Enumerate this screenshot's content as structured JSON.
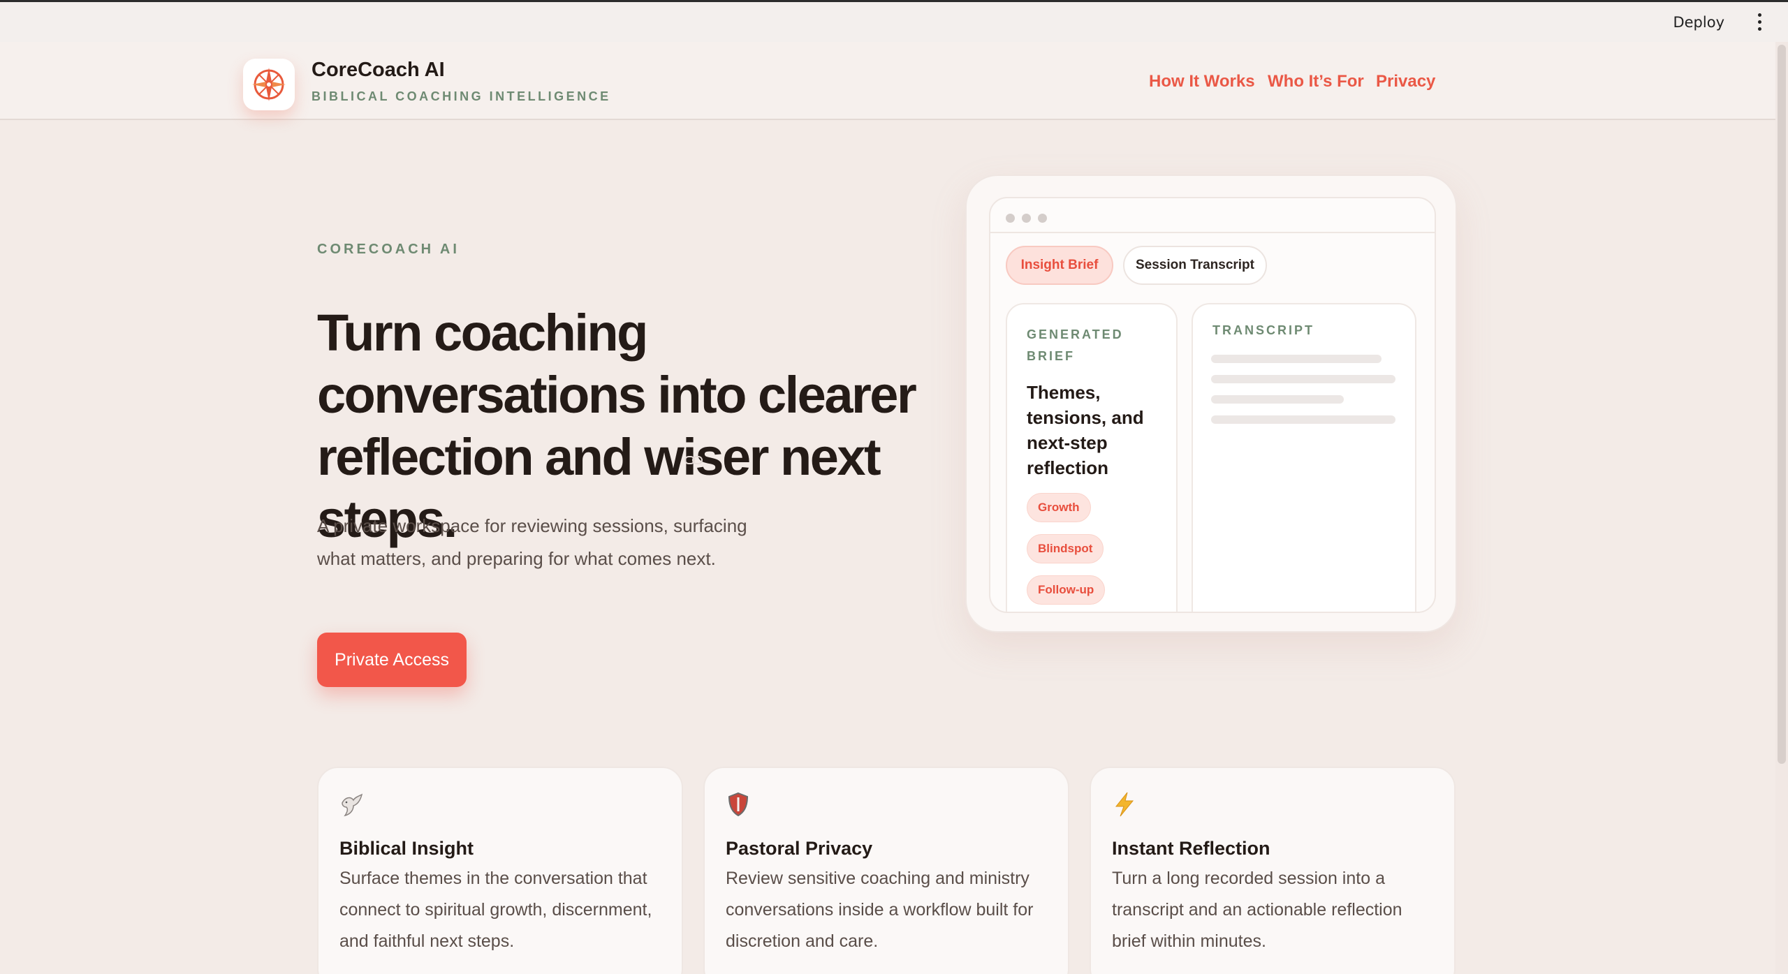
{
  "topbar": {
    "deploy_label": "Deploy",
    "menu_icon": "kebab-menu-icon"
  },
  "header": {
    "logo_icon": "compass-icon",
    "title": "CoreCoach AI",
    "subtitle": "BIBLICAL COACHING INTELLIGENCE",
    "nav": [
      {
        "label": "How It Works"
      },
      {
        "label": "Who It’s For"
      },
      {
        "label": "Privacy"
      }
    ]
  },
  "hero": {
    "eyebrow": "CORECOACH AI",
    "headline": "Turn coaching conversations into clearer reflection and wiser next steps.",
    "subtext": "A private workspace for reviewing sessions, surfacing what matters, and preparing for what comes next.",
    "cta_label": "Private Access",
    "link_icon": "link-icon"
  },
  "mockup": {
    "tabs": [
      {
        "label": "Insight Brief"
      },
      {
        "label": "Session Transcript"
      }
    ],
    "brief": {
      "eyebrow_line1": "GENERATED",
      "eyebrow_line2": "BRIEF",
      "title": "Themes, tensions, and next-step reflection",
      "chips": [
        "Growth",
        "Blindspot",
        "Follow-up"
      ]
    },
    "transcript": {
      "eyebrow": "TRANSCRIPT"
    }
  },
  "features": [
    {
      "icon": "dove-icon",
      "title": "Biblical Insight",
      "body": "Surface themes in the conversation that connect to spiritual growth, discernment, and faithful next steps."
    },
    {
      "icon": "shield-icon",
      "title": "Pastoral Privacy",
      "body": "Review sensitive coaching and ministry conversations inside a workflow built for discretion and care."
    },
    {
      "icon": "lightning-icon",
      "title": "Instant Reflection",
      "body": "Turn a long recorded session into a transcript and an actionable reflection brief within minutes."
    }
  ],
  "colors": {
    "accent": "#f2574a",
    "accent_text": "#ea5846",
    "eyebrow_green": "#6e8a72",
    "background": "#f3ebe7"
  }
}
